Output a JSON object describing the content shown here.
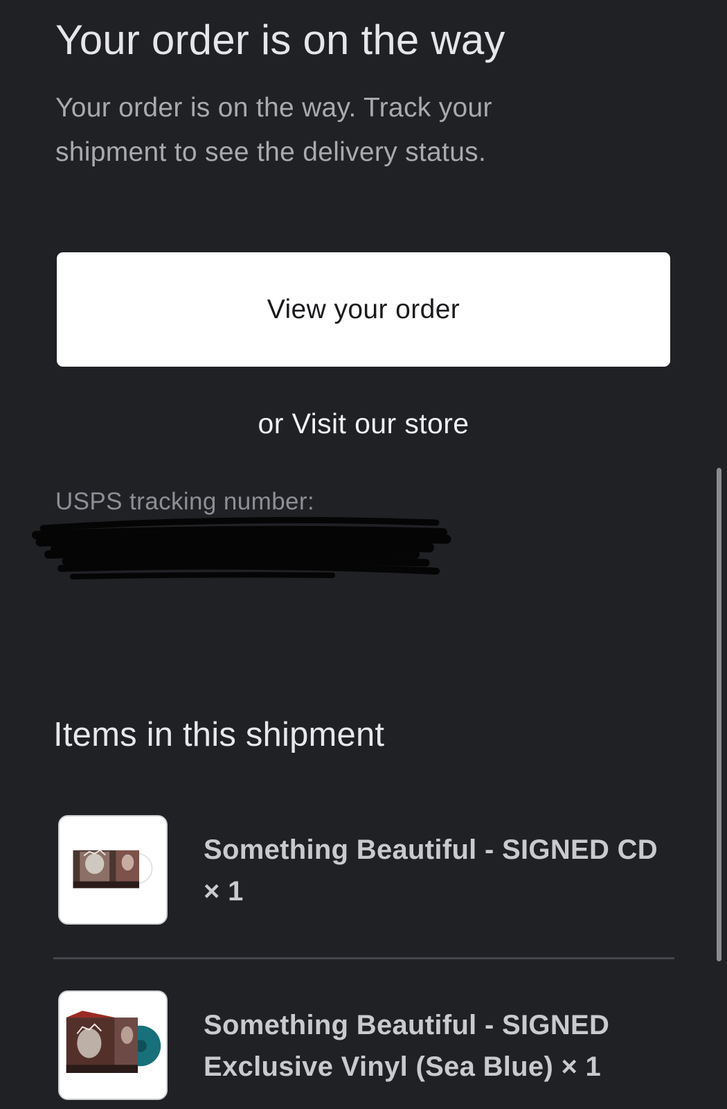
{
  "header": {
    "title": "Your order is on the way",
    "subtitle": "Your order is on the way. Track your shipment to see the delivery status."
  },
  "actions": {
    "view_order_label": "View your order",
    "store_prefix": "or",
    "store_link_label": "Visit our store"
  },
  "tracking": {
    "label": "USPS tracking number:"
  },
  "shipment": {
    "title": "Items in this shipment",
    "items": [
      {
        "name": "Something Beautiful - SIGNED CD × 1",
        "thumbnail_icon": "album-cd-thumbnail"
      },
      {
        "name": "Something Beautiful - SIGNED Exclusive Vinyl (Sea Blue) × 1",
        "thumbnail_icon": "album-vinyl-thumbnail"
      }
    ]
  },
  "colors": {
    "background": "#202125",
    "button_bg": "#ffffff",
    "button_text": "#1b1b1e",
    "heading_text": "#e6e6e8",
    "muted_text": "#a9aaae",
    "vinyl_sea_blue": "#17707a"
  }
}
